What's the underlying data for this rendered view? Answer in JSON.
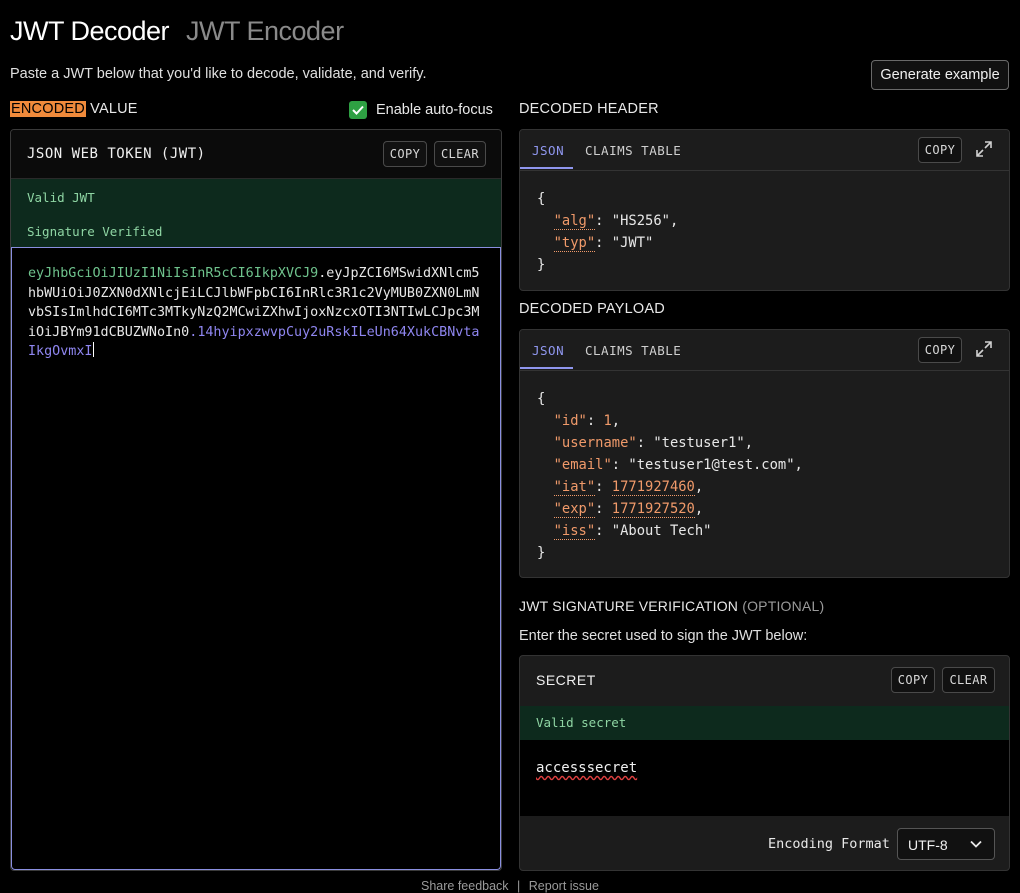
{
  "header": {
    "tab_decoder": "JWT Decoder",
    "tab_encoder": "JWT Encoder",
    "subtitle": "Paste a JWT below that you'd like to decode, validate, and verify.",
    "generate_button": "Generate example"
  },
  "encoded": {
    "label_highlight": "ENCODED",
    "label_rest": " VALUE",
    "autofocus_label": "Enable auto-focus",
    "autofocus_checked": true,
    "panel_title": "JSON WEB TOKEN (JWT)",
    "copy_label": "COPY",
    "clear_label": "CLEAR",
    "status_valid": "Valid JWT",
    "status_signature": "Signature Verified",
    "token_header": "eyJhbGciOiJIUzI1NiIsInR5cCI6IkpXVCJ9",
    "token_payload": "eyJpZCI6MSwidXNlcm5hbWUiOiJ0ZXN0dXNlcjEiLCJlbWFpbCI6InRlc3R1c2VyMUB0ZXN0LmNvbSIsImlhdCI6MTc3MTkyNzQ2MCwiZXhwIjoxNzcxOTI3NTIwLCJpc3MiOiJBYm91dCBUZWNoIn0",
    "token_signature": "14hyipxzwvpCuy2uRskILeUn64XukCBNvtaIkgOvmxI",
    "dot": "."
  },
  "decoded_header": {
    "label": "DECODED HEADER",
    "tab_json": "JSON",
    "tab_claims": "CLAIMS TABLE",
    "copy_label": "COPY",
    "open_brace": "{",
    "close_brace": "}",
    "alg_key": "\"alg\"",
    "alg_val": "\"HS256\"",
    "typ_key": "\"typ\"",
    "typ_val": "\"JWT\""
  },
  "decoded_payload": {
    "label": "DECODED PAYLOAD",
    "tab_json": "JSON",
    "tab_claims": "CLAIMS TABLE",
    "copy_label": "COPY",
    "open_brace": "{",
    "close_brace": "}",
    "id_key": "\"id\"",
    "id_val": "1",
    "username_key": "\"username\"",
    "username_val": "\"testuser1\"",
    "email_key": "\"email\"",
    "email_val": "\"testuser1@test.com\"",
    "iat_key": "\"iat\"",
    "iat_val": "1771927460",
    "exp_key": "\"exp\"",
    "exp_val": "1771927520",
    "iss_key": "\"iss\"",
    "iss_val": "\"About Tech\""
  },
  "verification": {
    "label": "JWT SIGNATURE VERIFICATION",
    "optional": "(OPTIONAL)",
    "instruction": "Enter the secret used to sign the JWT below:",
    "panel_title": "SECRET",
    "copy_label": "COPY",
    "clear_label": "CLEAR",
    "status": "Valid secret",
    "secret_value": "accesssecret",
    "encoding_label": "Encoding Format",
    "encoding_value": "UTF-8"
  },
  "footer": {
    "feedback": "Share feedback",
    "separator": "|",
    "report": "Report issue"
  },
  "colors": {
    "accent_orange": "#f08a3b",
    "valid_green": "#8fd6a4",
    "token_header_green": "#6fc38d",
    "token_signature_purple": "#8f86f0",
    "tab_active": "#8f96ee",
    "json_key": "#f09a6a"
  }
}
